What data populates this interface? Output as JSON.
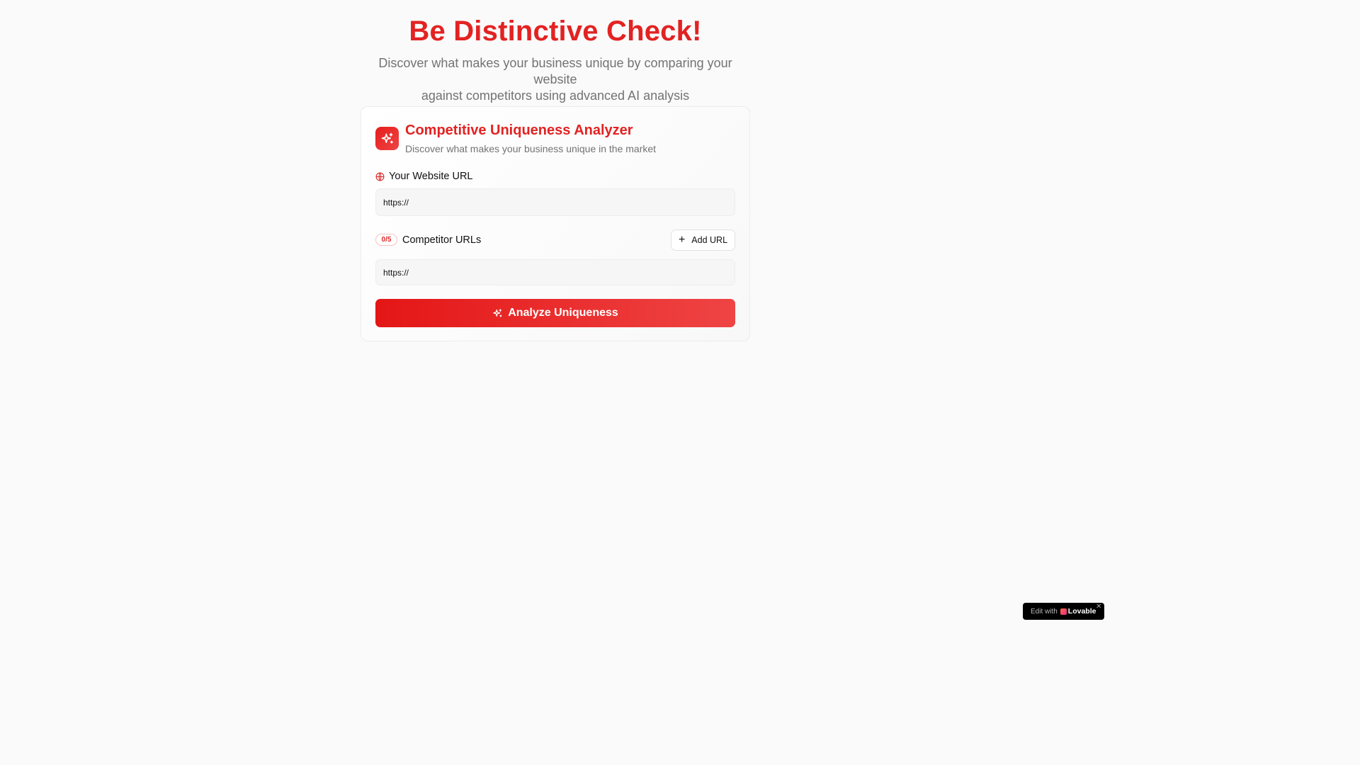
{
  "hero": {
    "title": "Be Distinctive Check!",
    "subtitle_line1": "Discover what makes your business unique by comparing your website",
    "subtitle_line2": "against competitors using advanced AI analysis"
  },
  "card": {
    "icon": "sparkles-icon",
    "title": "Competitive Uniqueness Analyzer",
    "subtitle": "Discover what makes your business unique in the market"
  },
  "website": {
    "label": "Your Website URL",
    "icon": "globe-icon",
    "value": "https://"
  },
  "competitors": {
    "count_badge": "0/5",
    "label": "Competitor URLs",
    "add_button_label": "Add URL",
    "inputs": [
      {
        "value": "https://"
      }
    ]
  },
  "analyze_button": {
    "label": "Analyze Uniqueness",
    "icon": "sparkles-icon"
  },
  "badge": {
    "edit_text": "Edit with",
    "brand": "Lovable",
    "close": "✕"
  },
  "colors": {
    "accent": "#e32222",
    "muted_text": "#737373",
    "background": "#fafafa"
  }
}
